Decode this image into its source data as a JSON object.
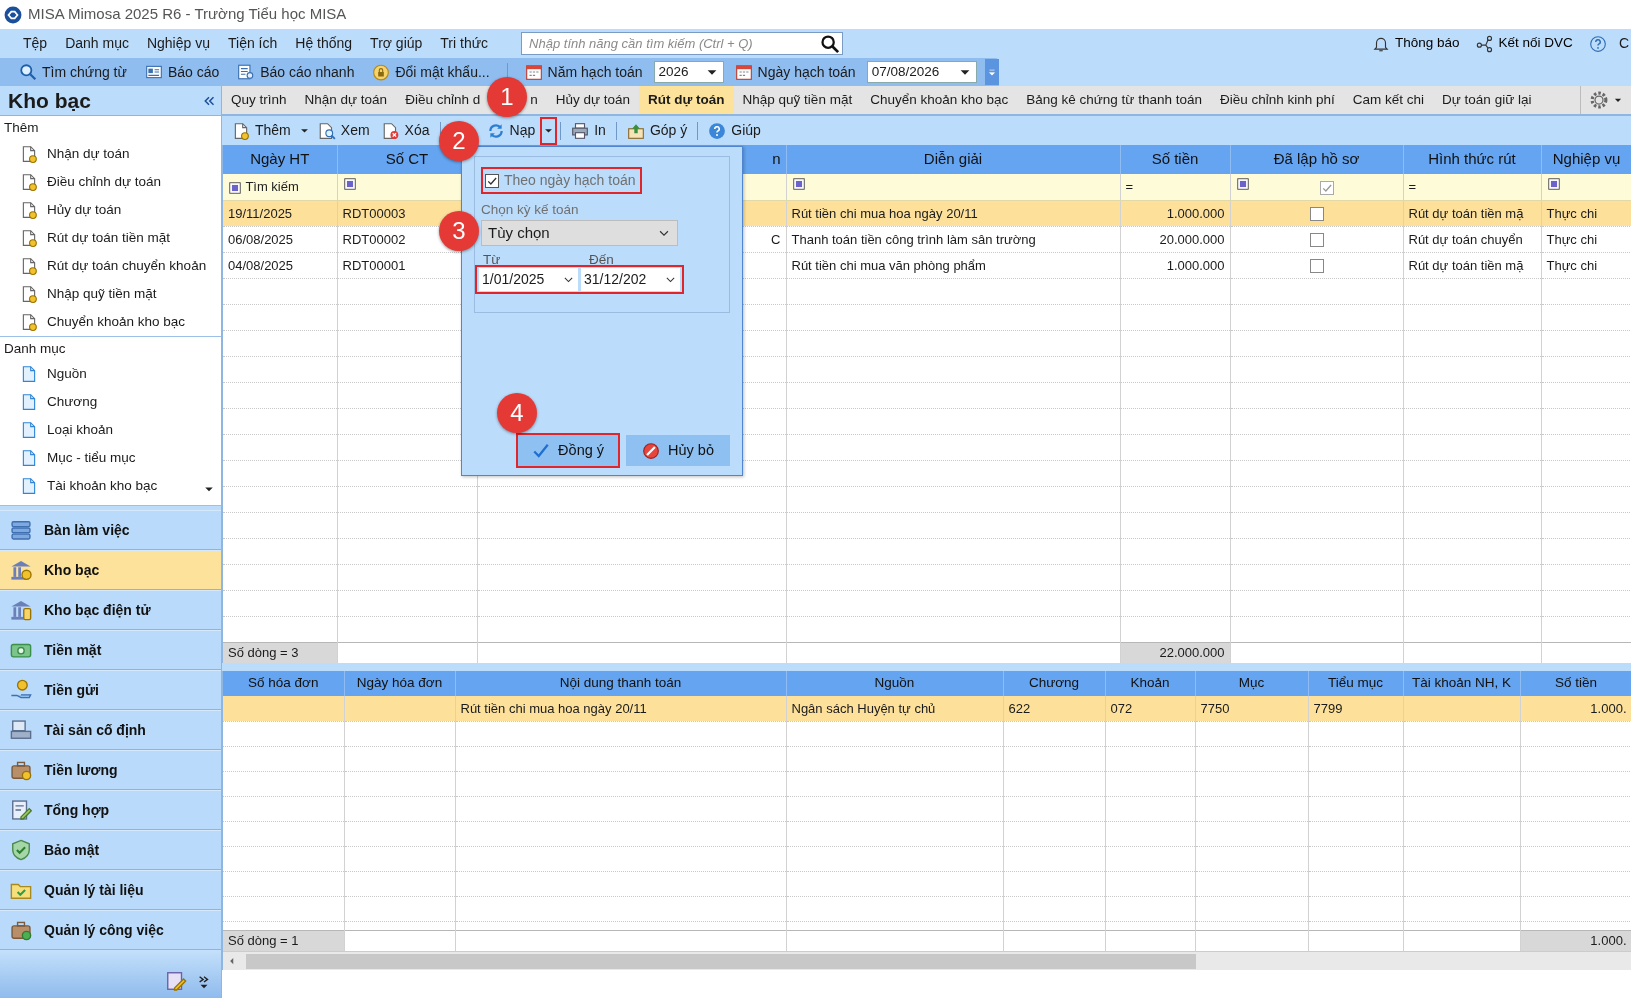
{
  "window": {
    "title": "MISA Mimosa 2025 R6 - Trường Tiểu học MISA"
  },
  "menu": [
    "Tệp",
    "Danh mục",
    "Nghiệp vụ",
    "Tiện ích",
    "Hệ thống",
    "Trợ giúp",
    "Tri thức"
  ],
  "search": {
    "placeholder": "Nhập tính năng cần tìm kiếm (Ctrl + Q)"
  },
  "header_links": [
    "Thông báo",
    "Kết nối DVC"
  ],
  "edge_text": "C",
  "toolbar": [
    "Tìm chứng từ",
    "Báo cáo",
    "Báo cáo nhanh",
    "Đổi mật khẩu..."
  ],
  "year": {
    "label": "Năm hạch toán",
    "value": "2026"
  },
  "posting_date": {
    "label": "Ngày hạch toán",
    "value": "07/08/2026"
  },
  "sidebar": {
    "title": "Kho bạc",
    "groups": [
      {
        "label": "Thêm",
        "items": [
          "Nhận dự toán",
          "Điều chỉnh dự toán",
          "Hủy dự toán",
          "Rút dự toán tiền mặt",
          "Rút dự toán chuyển khoản",
          "Nhập quỹ tiền mặt",
          "Chuyển khoản kho bạc"
        ]
      },
      {
        "label": "Danh mục",
        "items": [
          "Nguồn",
          "Chương",
          "Loại khoản",
          "Mục - tiểu mục",
          "Tài khoản kho bạc"
        ]
      }
    ],
    "nav": [
      {
        "label": "Bàn làm việc",
        "selected": false
      },
      {
        "label": "Kho bạc",
        "selected": true
      },
      {
        "label": "Kho bạc điện tử",
        "selected": false
      },
      {
        "label": "Tiền mặt",
        "selected": false
      },
      {
        "label": "Tiền gửi",
        "selected": false
      },
      {
        "label": "Tài sản cố định",
        "selected": false
      },
      {
        "label": "Tiền lương",
        "selected": false
      },
      {
        "label": "Tổng hợp",
        "selected": false
      },
      {
        "label": "Bảo mật",
        "selected": false
      },
      {
        "label": "Quản lý tài liệu",
        "selected": false
      },
      {
        "label": "Quản lý công việc",
        "selected": false
      }
    ]
  },
  "tabs": [
    {
      "label": "Quy trình",
      "selected": false
    },
    {
      "label": "Nhận dự toán",
      "selected": false
    },
    {
      "label": "Điều chỉnh d",
      "label_tail": "n",
      "selected": false
    },
    {
      "label": "Hủy dự toán",
      "selected": false
    },
    {
      "label": "Rút dự toán",
      "selected": true
    },
    {
      "label": "Nhập quỹ tiền mặt",
      "selected": false
    },
    {
      "label": "Chuyển khoản kho bạc",
      "selected": false
    },
    {
      "label": "Bảng kê chứng từ thanh toán",
      "selected": false
    },
    {
      "label": "Điều chỉnh kinh phí",
      "selected": false
    },
    {
      "label": "Cam kết chi",
      "selected": false
    },
    {
      "label": "Dự toán giữ lại",
      "selected": false
    }
  ],
  "actions": [
    {
      "label": "Thêm",
      "dropdown": true
    },
    {
      "label": "Xem"
    },
    {
      "label": "Xóa"
    },
    {
      "label": "Nạp",
      "dropdown": true,
      "highlighted": true
    },
    {
      "label": "In"
    },
    {
      "label": "Góp ý"
    },
    {
      "label": "Giúp"
    }
  ],
  "vouchers": {
    "columns": [
      "Ngày HT",
      "Số CT",
      "n",
      "Diễn giải",
      "Số tiền",
      "Đã lập hồ sơ",
      "Hình thức rút",
      "Nghiệp vụ"
    ],
    "filter": [
      {
        "kind": "box",
        "text": "Tìm kiếm"
      },
      {
        "kind": "box"
      },
      {
        "kind": "empty"
      },
      {
        "kind": "box"
      },
      {
        "kind": "symbol",
        "text": "="
      },
      {
        "kind": "box_check",
        "checked": true
      },
      {
        "kind": "symbol",
        "text": "="
      },
      {
        "kind": "box"
      }
    ],
    "rows": [
      {
        "selected": true,
        "ngay_ht": "19/11/2025",
        "so_ct": "RDT00003",
        "dien_giai": "Rút tiền chi mua hoa ngày 20/11",
        "so_tien": "1.000.000",
        "da_lap_ho_so": false,
        "hinh_thuc_rut": "Rút dự toán tiền mặ",
        "nghiep_vu": "Thực chi"
      },
      {
        "selected": false,
        "ngay_ht": "06/08/2025",
        "so_ct": "RDT00002",
        "column_3": "C",
        "dien_giai": "Thanh toán tiền công trình làm sân trường",
        "so_tien": "20.000.000",
        "da_lap_ho_so": false,
        "hinh_thuc_rut": "Rút dự toán chuyển",
        "nghiep_vu": "Thực chi"
      },
      {
        "selected": false,
        "ngay_ht": "04/08/2025",
        "so_ct": "RDT00001",
        "dien_giai": "Rút tiền chi mua văn phòng phẩm",
        "so_tien": "1.000.000",
        "da_lap_ho_so": false,
        "hinh_thuc_rut": "Rút dự toán tiền mặ",
        "nghiep_vu": "Thực chi"
      }
    ],
    "footer": {
      "count": "Số dòng = 3",
      "total": "22.000.000"
    }
  },
  "details": {
    "columns": [
      "Số hóa đơn",
      "Ngày hóa đơn",
      "Nội dung thanh toán",
      "Nguồn",
      "Chương",
      "Khoản",
      "Mục",
      "Tiểu mục",
      "Tài khoản NH, K",
      "Số tiền"
    ],
    "rows": [
      {
        "selected": true,
        "noi_dung": "Rút tiền chi mua hoa ngày 20/11",
        "nguon": "Ngân sách Huyện tự chủ",
        "chuong": "622",
        "khoan": "072",
        "muc": "7750",
        "tieu_muc": "7799",
        "so_tien": "1.000."
      }
    ],
    "footer": {
      "count": "Số dòng = 1",
      "total": "1.000."
    }
  },
  "filter_popup": {
    "by_date": {
      "label": "Theo ngày hạch toán",
      "checked": true,
      "highlighted": true
    },
    "period": {
      "label": "Chọn kỳ kế toán",
      "value": "Tùy chọn"
    },
    "from": {
      "label": "Từ",
      "value": "1/01/2025"
    },
    "to": {
      "label": "Đến",
      "value": "31/12/202"
    },
    "range_highlighted": true,
    "buttons": [
      {
        "label": "Đồng ý",
        "kind": "ok",
        "highlighted": true
      },
      {
        "label": "Hủy bỏ",
        "kind": "cancel",
        "highlighted": false
      }
    ]
  },
  "annotations": [
    "1",
    "2",
    "3",
    "4"
  ]
}
